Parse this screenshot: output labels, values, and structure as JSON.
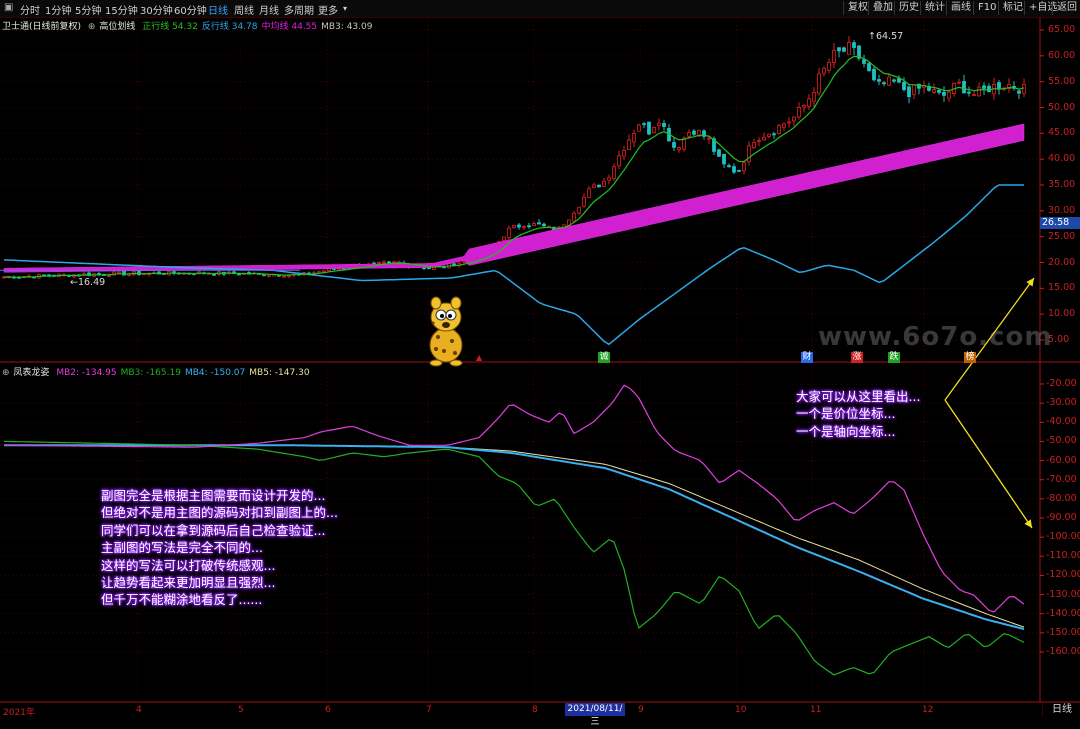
{
  "toolbar": {
    "periods": [
      "分时",
      "1分钟",
      "5分钟",
      "15分钟",
      "30分钟",
      "60分钟",
      "日线",
      "周线",
      "月线",
      "多周期",
      "更多"
    ],
    "active_period": "日线",
    "right_buttons": [
      "复权",
      "叠加",
      "历史",
      "统计",
      "画线",
      "F10",
      "标记",
      "+自选",
      "返回"
    ]
  },
  "main_legend": {
    "stock": "卫士通(日线前复权)",
    "indicator": "高位划线",
    "items": [
      {
        "label": "正行线",
        "value": "54.32",
        "color": "#22c022"
      },
      {
        "label": "反行线",
        "value": "34.78",
        "color": "#2aa8e8"
      },
      {
        "label": "中均线",
        "value": "44.55",
        "color": "#e020e0"
      },
      {
        "label": "MB3:",
        "value": "43.09",
        "color": "#c8c8c8"
      }
    ]
  },
  "sub_legend": {
    "indicator": "凤表龙姿",
    "items": [
      {
        "label": "MB2:",
        "value": "-134.95",
        "color": "#e040e0"
      },
      {
        "label": "MB3:",
        "value": "-165.19",
        "color": "#22b022"
      },
      {
        "label": "MB4:",
        "value": "-150.07",
        "color": "#3ab0f0"
      },
      {
        "label": "MB5:",
        "value": "-147.30",
        "color": "#e8e0a0"
      }
    ]
  },
  "price_axis": [
    "65.00",
    "60.00",
    "55.00",
    "50.00",
    "45.00",
    "40.00",
    "35.00",
    "30.00",
    "25.00",
    "20.00",
    "15.00",
    "10.00",
    "5.00"
  ],
  "price_tag": "26.58",
  "sub_axis": [
    "-20.00",
    "-30.00",
    "-40.00",
    "-50.00",
    "-60.00",
    "-70.00",
    "-80.00",
    "-90.00",
    "-100.00",
    "-110.00",
    "-120.00",
    "-130.00",
    "-140.00",
    "-150.00",
    "-160.00"
  ],
  "high_label": "64.57",
  "low_label": "16.49",
  "date_axis": [
    "2021年",
    "4",
    "5",
    "6",
    "7",
    "8",
    "9",
    "10",
    "11",
    "12"
  ],
  "date_tag": "2021/08/11/三",
  "bottom_tab": "日线",
  "watermark": "www.6o7o.com",
  "events": [
    {
      "text": "诚",
      "color": "#22a022"
    },
    {
      "text": "财",
      "color": "#2a6ae8"
    },
    {
      "text": "涨",
      "color": "#d02020"
    },
    {
      "text": "跌",
      "color": "#22a022"
    },
    {
      "text": "榜",
      "color": "#c06000"
    }
  ],
  "annotation_right": [
    "大家可以从这里看出...",
    "一个是价位坐标...",
    "一个是轴向坐标..."
  ],
  "annotation_left": [
    "副图完全是根据主图需要而设计开发的...",
    "但绝对不是用主图的源码对扣到副图上的...",
    "同学们可以在拿到源码后自己检查验证...",
    "主副图的写法是完全不同的...",
    "这样的写法可以打破传统感观...",
    "让趋势看起来更加明显且强烈...",
    "但千万不能糊涂地看反了......"
  ],
  "colors": {
    "grid": "#5a0000",
    "axis": "#c82020",
    "up": "#e02020",
    "down": "#20c0c0"
  }
}
